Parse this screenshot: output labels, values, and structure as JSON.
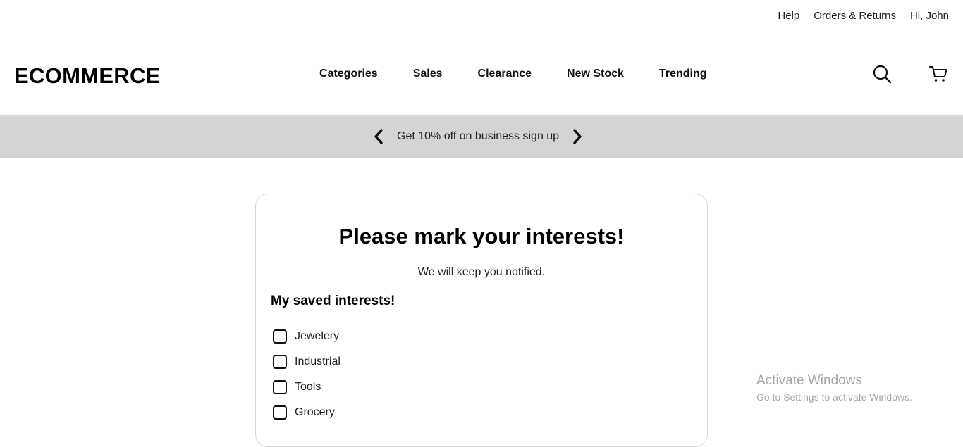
{
  "top_links": {
    "help": "Help",
    "orders": "Orders & Returns",
    "greeting": "Hi, John"
  },
  "header": {
    "logo": "ECOMMERCE",
    "nav": [
      "Categories",
      "Sales",
      "Clearance",
      "New Stock",
      "Trending"
    ],
    "icons": [
      "search-icon",
      "cart-icon"
    ]
  },
  "promo": {
    "text": "Get 10% off on business sign up",
    "background": "#d4d4d4"
  },
  "card": {
    "title": "Please mark your interests!",
    "subtitle": "We will keep you notified.",
    "saved_heading": "My saved interests!",
    "interests": [
      {
        "label": "Jewelery",
        "checked": false
      },
      {
        "label": "Industrial",
        "checked": false
      },
      {
        "label": "Tools",
        "checked": false
      },
      {
        "label": "Grocery",
        "checked": false
      }
    ]
  },
  "watermark": {
    "title": "Activate Windows",
    "subtitle": "Go to Settings to activate Windows."
  }
}
